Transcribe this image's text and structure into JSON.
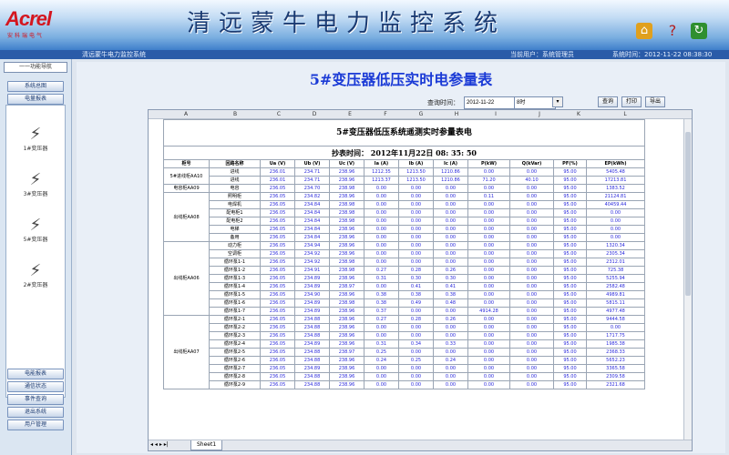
{
  "app": {
    "logo": "Acrel",
    "logo_sub": "安科瑞电气",
    "title": "清远蒙牛电力监控系统"
  },
  "menubar": {
    "left": "清远蒙牛电力监控系统",
    "right": [
      "当前用户：系统管理员",
      "系统时间：2012-11-22 08:38:30"
    ]
  },
  "sidebar": {
    "search": "一一功能导航",
    "top_buttons": [
      "系统总图",
      "电量报表"
    ],
    "items": [
      {
        "icon": "transformer-icon",
        "label": "1#变压器"
      },
      {
        "icon": "transformer-icon",
        "label": "3#变压器"
      },
      {
        "icon": "transformer-icon",
        "label": "5#变压器"
      },
      {
        "icon": "transformer-icon",
        "label": "2#变压器"
      }
    ],
    "bottom_buttons": [
      "电能报表",
      "通信状态",
      "事件查询",
      "退出系统",
      "用户管理"
    ]
  },
  "report": {
    "title": "5#变压器低压实时电参量表",
    "query_label": "查询时间：",
    "date_value": "2012-11-22",
    "hour_value": "8时",
    "buttons": {
      "query": "查询",
      "print": "打印",
      "export": "导出"
    }
  },
  "sheet": {
    "col_letters": [
      "A",
      "B",
      "C",
      "D",
      "E",
      "F",
      "G",
      "H",
      "I",
      "J",
      "K",
      "L"
    ],
    "table_title": "5#变压器低压系统遥测实时参量表电",
    "time_text": "抄表时间： 2012年11月22日 08: 35: 50",
    "headers": [
      "柜号",
      "回路名称",
      "Ua (V)",
      "Ub (V)",
      "Uc (V)",
      "Ia (A)",
      "Ib (A)",
      "Ic (A)",
      "P(kW)",
      "Q(kVar)",
      "PF(%)",
      "EP(kWh)"
    ],
    "groups": [
      {
        "name": "5#进线柜AA10",
        "rows": [
          [
            "进线",
            "236.01",
            "234.71",
            "238.96",
            "1212.35",
            "1213.50",
            "1210.86",
            "0.00",
            "0.00",
            "95.00",
            "5405.48"
          ],
          [
            "进线",
            "236.01",
            "234.71",
            "238.96",
            "1213.37",
            "1213.50",
            "1210.86",
            "71.20",
            "40.10",
            "95.00",
            "17213.81"
          ]
        ]
      },
      {
        "name": "电容柜AA09",
        "rows": [
          [
            "电容",
            "236.05",
            "234.70",
            "238.98",
            "0.00",
            "0.00",
            "0.00",
            "0.00",
            "0.00",
            "95.00",
            "1383.52"
          ]
        ]
      },
      {
        "name": "出线柜AA08",
        "rows": [
          [
            "照明柜",
            "236.05",
            "234.82",
            "238.96",
            "0.00",
            "0.00",
            "0.00",
            "0.11",
            "0.00",
            "95.00",
            "21124.81"
          ],
          [
            "电焊机",
            "236.05",
            "234.84",
            "238.98",
            "0.00",
            "0.00",
            "0.00",
            "0.00",
            "0.00",
            "95.00",
            "40459.44"
          ],
          [
            "配电柜1",
            "236.05",
            "234.84",
            "238.98",
            "0.00",
            "0.00",
            "0.00",
            "0.00",
            "0.00",
            "95.00",
            "0.00"
          ],
          [
            "配电柜2",
            "236.05",
            "234.84",
            "238.98",
            "0.00",
            "0.00",
            "0.00",
            "0.00",
            "0.00",
            "95.00",
            "0.00"
          ],
          [
            "电梯",
            "236.05",
            "234.84",
            "238.96",
            "0.00",
            "0.00",
            "0.00",
            "0.00",
            "0.00",
            "95.00",
            "0.00"
          ],
          [
            "备用",
            "236.05",
            "234.84",
            "238.96",
            "0.00",
            "0.00",
            "0.00",
            "0.00",
            "0.00",
            "95.00",
            "0.00"
          ]
        ]
      },
      {
        "name": "出线柜AA06",
        "rows": [
          [
            "动力柜",
            "236.05",
            "234.94",
            "238.96",
            "0.00",
            "0.00",
            "0.00",
            "0.00",
            "0.00",
            "95.00",
            "1320.34"
          ],
          [
            "空调柜",
            "236.05",
            "234.92",
            "238.96",
            "0.00",
            "0.00",
            "0.00",
            "0.00",
            "0.00",
            "95.00",
            "2305.34"
          ],
          [
            "循环泵1-1",
            "236.05",
            "234.92",
            "238.98",
            "0.00",
            "0.00",
            "0.00",
            "0.00",
            "0.00",
            "95.00",
            "2312.01"
          ],
          [
            "循环泵1-2",
            "236.05",
            "234.91",
            "238.98",
            "0.27",
            "0.28",
            "0.26",
            "0.00",
            "0.00",
            "95.00",
            "725.38"
          ],
          [
            "循环泵1-3",
            "236.05",
            "234.89",
            "238.96",
            "0.31",
            "0.30",
            "0.30",
            "0.00",
            "0.00",
            "95.00",
            "5255.94"
          ],
          [
            "循环泵1-4",
            "236.05",
            "234.89",
            "238.97",
            "0.00",
            "0.41",
            "0.41",
            "0.00",
            "0.00",
            "95.00",
            "2582.48"
          ],
          [
            "循环泵1-5",
            "236.05",
            "234.90",
            "238.96",
            "0.38",
            "0.38",
            "0.38",
            "0.00",
            "0.00",
            "95.00",
            "4989.81"
          ],
          [
            "循环泵1-6",
            "236.05",
            "234.89",
            "238.98",
            "0.38",
            "0.49",
            "0.48",
            "0.00",
            "0.00",
            "95.00",
            "5815.11"
          ],
          [
            "循环泵1-7",
            "236.05",
            "234.89",
            "238.96",
            "0.37",
            "0.00",
            "0.00",
            "4914.28",
            "0.00",
            "95.00",
            "4977.48"
          ]
        ]
      },
      {
        "name": "出线柜AA07",
        "rows": [
          [
            "循环泵2-1",
            "236.05",
            "234.88",
            "238.96",
            "0.27",
            "0.28",
            "0.26",
            "0.00",
            "0.00",
            "95.00",
            "9444.58"
          ],
          [
            "循环泵2-2",
            "236.05",
            "234.88",
            "238.96",
            "0.00",
            "0.00",
            "0.00",
            "0.00",
            "0.00",
            "95.00",
            "0.00"
          ],
          [
            "循环泵2-3",
            "236.05",
            "234.88",
            "238.96",
            "0.00",
            "0.00",
            "0.00",
            "0.00",
            "0.00",
            "95.00",
            "1717.75"
          ],
          [
            "循环泵2-4",
            "236.05",
            "234.89",
            "238.96",
            "0.31",
            "0.34",
            "0.33",
            "0.00",
            "0.00",
            "95.00",
            "1985.38"
          ],
          [
            "循环泵2-5",
            "236.05",
            "234.88",
            "238.97",
            "0.25",
            "0.00",
            "0.00",
            "0.00",
            "0.00",
            "95.00",
            "2368.33"
          ],
          [
            "循环泵2-6",
            "236.05",
            "234.88",
            "238.96",
            "0.24",
            "0.25",
            "0.24",
            "0.00",
            "0.00",
            "95.00",
            "5652.23"
          ],
          [
            "循环泵2-7",
            "236.05",
            "234.89",
            "238.96",
            "0.00",
            "0.00",
            "0.00",
            "0.00",
            "0.00",
            "95.00",
            "3365.58"
          ],
          [
            "循环泵2-8",
            "236.05",
            "234.88",
            "238.96",
            "0.00",
            "0.00",
            "0.00",
            "0.00",
            "0.00",
            "95.00",
            "2309.58"
          ],
          [
            "循环泵2-9",
            "236.05",
            "234.88",
            "238.96",
            "0.00",
            "0.00",
            "0.00",
            "0.00",
            "0.00",
            "95.00",
            "2321.68"
          ]
        ]
      }
    ],
    "sheet_nav": "◂ ◂ ▸ ▸|",
    "sheet_tab": "Sheet1"
  }
}
